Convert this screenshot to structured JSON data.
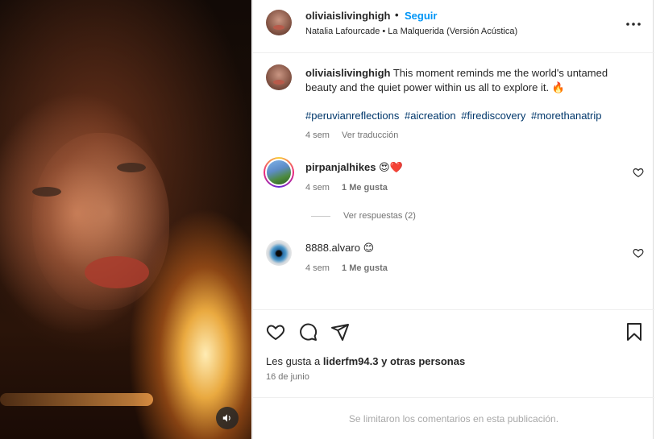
{
  "header": {
    "username": "oliviaislivinghigh",
    "separator": "•",
    "follow_label": "Seguir",
    "song": "Natalia Lafourcade • La Malquerida (Versión Acústica)",
    "more_icon": "more-horizontal-icon"
  },
  "caption": {
    "username": "oliviaislivinghigh",
    "text": "This moment reminds me the world's untamed beauty and the quiet power within us all to explore it. 🔥",
    "hashtags": [
      "#peruvianreflections",
      "#aicreation",
      "#firediscovery",
      "#morethanatrip"
    ],
    "time": "4 sem",
    "translate_label": "Ver traducción"
  },
  "comments": [
    {
      "username": "pirpanjalhikes",
      "text": "😍❤️",
      "time": "4 sem",
      "likes": "1 Me gusta",
      "replies_label": "Ver respuestas (2)"
    },
    {
      "username": "8888.alvaro",
      "text": "😊",
      "time": "4 sem",
      "likes": "1 Me gusta"
    }
  ],
  "actions": {
    "like_icon": "heart-icon",
    "comment_icon": "comment-icon",
    "share_icon": "share-icon",
    "save_icon": "bookmark-icon"
  },
  "likes_summary": {
    "prefix": "Les gusta a",
    "user": "liderfm94.3",
    "suffix": "y otras personas"
  },
  "date": "16 de junio",
  "comments_limited": "Se limitaron los comentarios en esta publicación.",
  "media": {
    "audio_icon": "volume-icon"
  },
  "colors": {
    "link": "#0095f6",
    "hashtag": "#00376b",
    "text": "#262626",
    "secondary": "#737373"
  }
}
